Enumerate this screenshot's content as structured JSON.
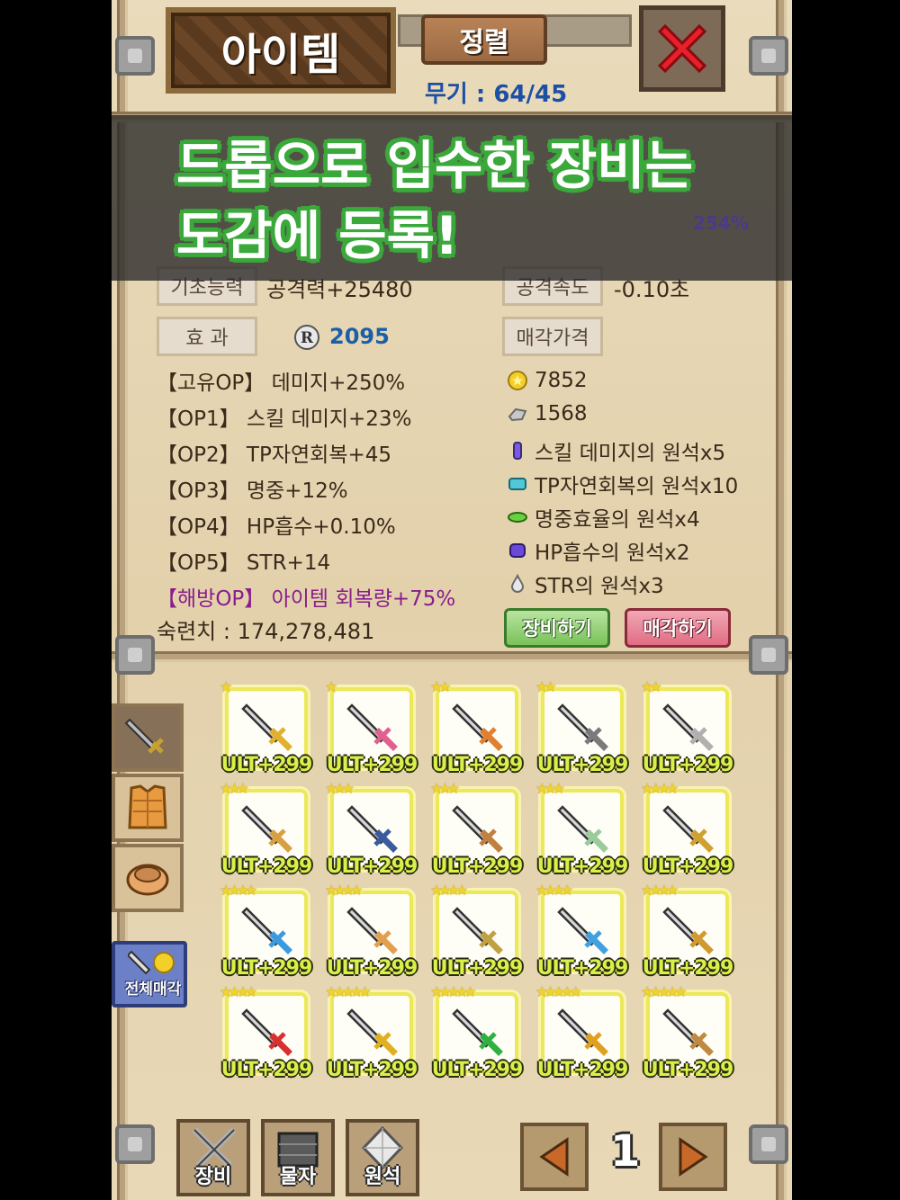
{
  "header": {
    "title": "아이템",
    "sort_label": "정렬",
    "weapon_count": "무기 : 64/45"
  },
  "banner": {
    "line1": "드롭으로 입수한 장비는",
    "line2": "도감에 등록!",
    "bg_percent": "254%"
  },
  "stats": {
    "base_label": "기초능력",
    "base_value": "공격력+25480",
    "speed_label": "공격속도",
    "speed_value": "-0.10초",
    "effect_label": "효 과",
    "effect_value": "2095",
    "sell_label": "매각가격"
  },
  "options": [
    "【고유OP】 데미지+250%",
    "【OP1】 스킬 데미지+23%",
    "【OP2】 TP자연회복+45",
    "【OP3】 명중+12%",
    "【OP4】 HP흡수+0.10%",
    "【OP5】 STR+14",
    "【해방OP】 아이템 회복량+75%"
  ],
  "sell_items": [
    {
      "icon": "gold-coin-icon",
      "text": "7852"
    },
    {
      "icon": "silver-ore-icon",
      "text": "1568"
    },
    {
      "icon": "purple-crystal-icon",
      "text": "스킬 데미지의 원석x5"
    },
    {
      "icon": "cyan-crystal-icon",
      "text": "TP자연회복의 원석x10"
    },
    {
      "icon": "green-crystal-icon",
      "text": "명중효율의 원석x4"
    },
    {
      "icon": "violet-crystal-icon",
      "text": "HP흡수의 원석x2"
    },
    {
      "icon": "drop-crystal-icon",
      "text": "STR의 원석x3"
    }
  ],
  "mastery": "숙련치 : 174,278,481",
  "buttons": {
    "equip": "장비하기",
    "sell": "매각하기",
    "sell_all": "전체매각"
  },
  "items": [
    {
      "level": "ULT+299",
      "stars": "★",
      "color": "#e0b030"
    },
    {
      "level": "ULT+299",
      "stars": "★",
      "color": "#e06090"
    },
    {
      "level": "ULT+299",
      "stars": "★★",
      "color": "#e08030"
    },
    {
      "level": "ULT+299",
      "stars": "★★",
      "color": "#7a7a7a"
    },
    {
      "level": "ULT+299",
      "stars": "★★",
      "color": "#b0b0b0"
    },
    {
      "level": "ULT+299",
      "stars": "★★★",
      "color": "#d8a040"
    },
    {
      "level": "ULT+299",
      "stars": "★★★",
      "color": "#3a5aa0"
    },
    {
      "level": "ULT+299",
      "stars": "★★★",
      "color": "#c08040"
    },
    {
      "level": "ULT+299",
      "stars": "★★★",
      "color": "#9acb9a"
    },
    {
      "level": "ULT+299",
      "stars": "★★★★",
      "color": "#d0a030"
    },
    {
      "level": "ULT+299",
      "stars": "★★★★",
      "color": "#3a9ae0"
    },
    {
      "level": "ULT+299",
      "stars": "★★★★",
      "color": "#e0a050"
    },
    {
      "level": "ULT+299",
      "stars": "★★★★",
      "color": "#c0a040"
    },
    {
      "level": "ULT+299",
      "stars": "★★★★",
      "color": "#40a0e0"
    },
    {
      "level": "ULT+299",
      "stars": "★★★★",
      "color": "#d09a30"
    },
    {
      "level": "ULT+299",
      "stars": "★★★★",
      "color": "#d83030"
    },
    {
      "level": "ULT+299",
      "stars": "★★★★★",
      "color": "#e0b020"
    },
    {
      "level": "ULT+299",
      "stars": "★★★★★",
      "color": "#30b040"
    },
    {
      "level": "ULT+299",
      "stars": "★★★★★",
      "color": "#e0a020"
    },
    {
      "level": "ULT+299",
      "stars": "★★★★★",
      "color": "#c08a40"
    }
  ],
  "bottom_nav": {
    "equipment": "장비",
    "materials": "물자",
    "gems": "원석",
    "page": "1"
  }
}
